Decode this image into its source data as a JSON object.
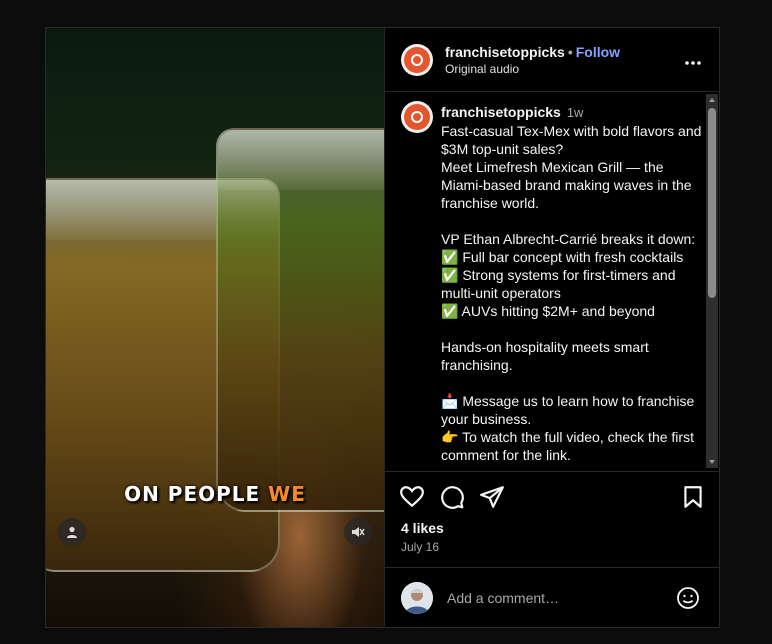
{
  "post": {
    "video": {
      "caption_overlay_prefix": "ON PEOPLE",
      "caption_overlay_highlight": "WE",
      "highlight_color": "#f58a2a",
      "user_tag_icon": "user-icon",
      "mute_icon": "speaker-muted-icon"
    },
    "header": {
      "username": "franchisetoppicks",
      "separator": "•",
      "follow_label": "Follow",
      "subtitle": "Original audio",
      "more_icon": "more-horizontal-icon"
    },
    "caption": {
      "username": "franchisetoppicks",
      "time_ago": "1w",
      "text": "Fast-casual Tex-Mex with bold flavors and $3M top-unit sales?\nMeet Limefresh Mexican Grill — the Miami-based brand making waves in the franchise world.\n\nVP Ethan Albrecht-Carrié breaks it down:\n✅ Full bar concept with fresh cocktails\n✅ Strong systems for first-timers and multi-unit operators\n✅ AUVs hitting $2M+ and beyond\n\nHands-on hospitality meets smart franchising.\n\n📩 Message us to learn how to franchise your business.\n👉 To watch the full video, check the first comment for the link."
    },
    "actions": {
      "like_icon": "heart-icon",
      "comment_icon": "comment-icon",
      "share_icon": "send-icon",
      "save_icon": "bookmark-icon",
      "likes": "4 likes",
      "date": "July 16"
    },
    "comment_box": {
      "placeholder": "Add a comment…",
      "emoji_icon": "smiley-icon"
    },
    "colors": {
      "brand_avatar": "#e4572e",
      "follow": "#85a3ff",
      "background": "#000000"
    }
  }
}
